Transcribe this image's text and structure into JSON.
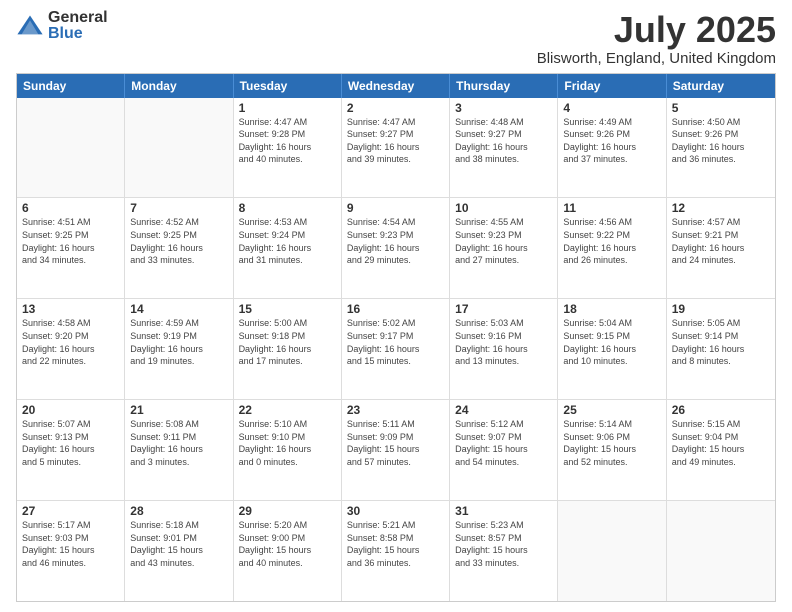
{
  "header": {
    "logo_general": "General",
    "logo_blue": "Blue",
    "main_title": "July 2025",
    "subtitle": "Blisworth, England, United Kingdom"
  },
  "calendar": {
    "days": [
      "Sunday",
      "Monday",
      "Tuesday",
      "Wednesday",
      "Thursday",
      "Friday",
      "Saturday"
    ],
    "rows": [
      [
        {
          "day": "",
          "content": "",
          "empty": true
        },
        {
          "day": "",
          "content": "",
          "empty": true
        },
        {
          "day": "1",
          "content": "Sunrise: 4:47 AM\nSunset: 9:28 PM\nDaylight: 16 hours\nand 40 minutes.",
          "empty": false
        },
        {
          "day": "2",
          "content": "Sunrise: 4:47 AM\nSunset: 9:27 PM\nDaylight: 16 hours\nand 39 minutes.",
          "empty": false
        },
        {
          "day": "3",
          "content": "Sunrise: 4:48 AM\nSunset: 9:27 PM\nDaylight: 16 hours\nand 38 minutes.",
          "empty": false
        },
        {
          "day": "4",
          "content": "Sunrise: 4:49 AM\nSunset: 9:26 PM\nDaylight: 16 hours\nand 37 minutes.",
          "empty": false
        },
        {
          "day": "5",
          "content": "Sunrise: 4:50 AM\nSunset: 9:26 PM\nDaylight: 16 hours\nand 36 minutes.",
          "empty": false
        }
      ],
      [
        {
          "day": "6",
          "content": "Sunrise: 4:51 AM\nSunset: 9:25 PM\nDaylight: 16 hours\nand 34 minutes.",
          "empty": false
        },
        {
          "day": "7",
          "content": "Sunrise: 4:52 AM\nSunset: 9:25 PM\nDaylight: 16 hours\nand 33 minutes.",
          "empty": false
        },
        {
          "day": "8",
          "content": "Sunrise: 4:53 AM\nSunset: 9:24 PM\nDaylight: 16 hours\nand 31 minutes.",
          "empty": false
        },
        {
          "day": "9",
          "content": "Sunrise: 4:54 AM\nSunset: 9:23 PM\nDaylight: 16 hours\nand 29 minutes.",
          "empty": false
        },
        {
          "day": "10",
          "content": "Sunrise: 4:55 AM\nSunset: 9:23 PM\nDaylight: 16 hours\nand 27 minutes.",
          "empty": false
        },
        {
          "day": "11",
          "content": "Sunrise: 4:56 AM\nSunset: 9:22 PM\nDaylight: 16 hours\nand 26 minutes.",
          "empty": false
        },
        {
          "day": "12",
          "content": "Sunrise: 4:57 AM\nSunset: 9:21 PM\nDaylight: 16 hours\nand 24 minutes.",
          "empty": false
        }
      ],
      [
        {
          "day": "13",
          "content": "Sunrise: 4:58 AM\nSunset: 9:20 PM\nDaylight: 16 hours\nand 22 minutes.",
          "empty": false
        },
        {
          "day": "14",
          "content": "Sunrise: 4:59 AM\nSunset: 9:19 PM\nDaylight: 16 hours\nand 19 minutes.",
          "empty": false
        },
        {
          "day": "15",
          "content": "Sunrise: 5:00 AM\nSunset: 9:18 PM\nDaylight: 16 hours\nand 17 minutes.",
          "empty": false
        },
        {
          "day": "16",
          "content": "Sunrise: 5:02 AM\nSunset: 9:17 PM\nDaylight: 16 hours\nand 15 minutes.",
          "empty": false
        },
        {
          "day": "17",
          "content": "Sunrise: 5:03 AM\nSunset: 9:16 PM\nDaylight: 16 hours\nand 13 minutes.",
          "empty": false
        },
        {
          "day": "18",
          "content": "Sunrise: 5:04 AM\nSunset: 9:15 PM\nDaylight: 16 hours\nand 10 minutes.",
          "empty": false
        },
        {
          "day": "19",
          "content": "Sunrise: 5:05 AM\nSunset: 9:14 PM\nDaylight: 16 hours\nand 8 minutes.",
          "empty": false
        }
      ],
      [
        {
          "day": "20",
          "content": "Sunrise: 5:07 AM\nSunset: 9:13 PM\nDaylight: 16 hours\nand 5 minutes.",
          "empty": false
        },
        {
          "day": "21",
          "content": "Sunrise: 5:08 AM\nSunset: 9:11 PM\nDaylight: 16 hours\nand 3 minutes.",
          "empty": false
        },
        {
          "day": "22",
          "content": "Sunrise: 5:10 AM\nSunset: 9:10 PM\nDaylight: 16 hours\nand 0 minutes.",
          "empty": false
        },
        {
          "day": "23",
          "content": "Sunrise: 5:11 AM\nSunset: 9:09 PM\nDaylight: 15 hours\nand 57 minutes.",
          "empty": false
        },
        {
          "day": "24",
          "content": "Sunrise: 5:12 AM\nSunset: 9:07 PM\nDaylight: 15 hours\nand 54 minutes.",
          "empty": false
        },
        {
          "day": "25",
          "content": "Sunrise: 5:14 AM\nSunset: 9:06 PM\nDaylight: 15 hours\nand 52 minutes.",
          "empty": false
        },
        {
          "day": "26",
          "content": "Sunrise: 5:15 AM\nSunset: 9:04 PM\nDaylight: 15 hours\nand 49 minutes.",
          "empty": false
        }
      ],
      [
        {
          "day": "27",
          "content": "Sunrise: 5:17 AM\nSunset: 9:03 PM\nDaylight: 15 hours\nand 46 minutes.",
          "empty": false
        },
        {
          "day": "28",
          "content": "Sunrise: 5:18 AM\nSunset: 9:01 PM\nDaylight: 15 hours\nand 43 minutes.",
          "empty": false
        },
        {
          "day": "29",
          "content": "Sunrise: 5:20 AM\nSunset: 9:00 PM\nDaylight: 15 hours\nand 40 minutes.",
          "empty": false
        },
        {
          "day": "30",
          "content": "Sunrise: 5:21 AM\nSunset: 8:58 PM\nDaylight: 15 hours\nand 36 minutes.",
          "empty": false
        },
        {
          "day": "31",
          "content": "Sunrise: 5:23 AM\nSunset: 8:57 PM\nDaylight: 15 hours\nand 33 minutes.",
          "empty": false
        },
        {
          "day": "",
          "content": "",
          "empty": true
        },
        {
          "day": "",
          "content": "",
          "empty": true
        }
      ]
    ]
  }
}
